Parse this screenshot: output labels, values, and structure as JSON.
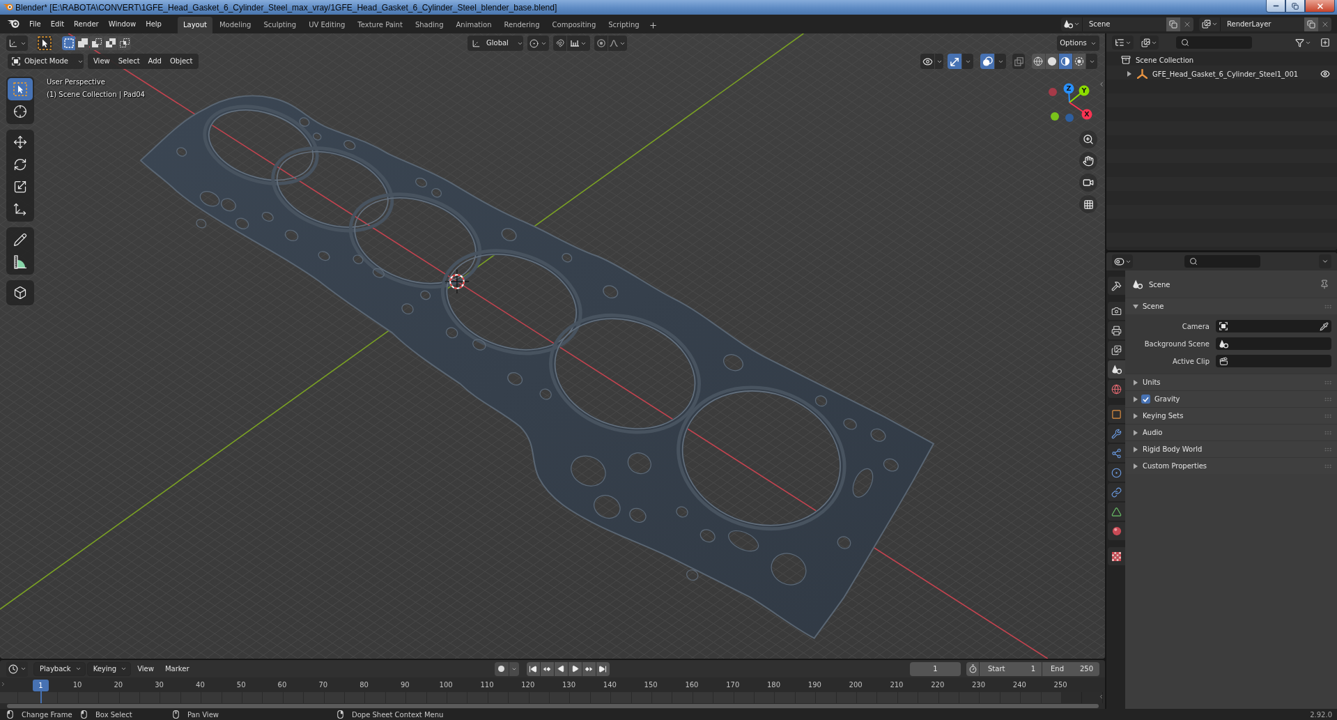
{
  "window": {
    "title": "Blender* [E:\\RABOTA\\CONVERT\\1GFE_Head_Gasket_6_Cylinder_Steel_max_vray/1GFE_Head_Gasket_6_Cylinder_Steel_blender_base.blend]"
  },
  "menu": [
    "File",
    "Edit",
    "Render",
    "Window",
    "Help"
  ],
  "workspaces": [
    {
      "label": "Layout",
      "selected": true
    },
    {
      "label": "Modeling",
      "selected": false
    },
    {
      "label": "Sculpting",
      "selected": false
    },
    {
      "label": "UV Editing",
      "selected": false
    },
    {
      "label": "Texture Paint",
      "selected": false
    },
    {
      "label": "Shading",
      "selected": false
    },
    {
      "label": "Animation",
      "selected": false
    },
    {
      "label": "Rendering",
      "selected": false
    },
    {
      "label": "Compositing",
      "selected": false
    },
    {
      "label": "Scripting",
      "selected": false
    }
  ],
  "scene": {
    "value": "Scene"
  },
  "view_layer": {
    "value": "RenderLayer"
  },
  "tool_header": {
    "select_modes": [
      {
        "kind": "set",
        "selected": true
      },
      {
        "kind": "extend",
        "selected": false
      },
      {
        "kind": "subtract",
        "selected": false
      },
      {
        "kind": "difference",
        "selected": false
      },
      {
        "kind": "intersect",
        "selected": false
      }
    ],
    "orientation": "Global",
    "options": "Options"
  },
  "viewport": {
    "mode": "Object Mode",
    "menus": [
      "View",
      "Select",
      "Add",
      "Object"
    ],
    "overlays": [
      {
        "kind": "visibility",
        "on": false
      },
      {
        "kind": "gizmos",
        "on": true
      },
      {
        "kind": "overlays",
        "on": true
      },
      {
        "kind": "xray",
        "on": false
      }
    ],
    "shading": [
      {
        "kind": "wireframe",
        "selected": false
      },
      {
        "kind": "solid",
        "selected": false
      },
      {
        "kind": "material",
        "selected": true
      },
      {
        "kind": "rendered",
        "selected": false
      }
    ],
    "view_name": "User Perspective",
    "info": "(1) Scene Collection | Pad04",
    "tool_groups": [
      {
        "tools": [
          {
            "kind": "select",
            "selected": true
          },
          {
            "kind": "cursor",
            "selected": false
          }
        ]
      },
      {
        "tools": [
          {
            "kind": "move",
            "selected": false
          },
          {
            "kind": "rotate",
            "selected": false
          },
          {
            "kind": "scale",
            "selected": false
          },
          {
            "kind": "transform",
            "selected": false
          }
        ]
      },
      {
        "tools": [
          {
            "kind": "annotate",
            "selected": false
          },
          {
            "kind": "measure",
            "selected": false
          }
        ]
      },
      {
        "tools": [
          {
            "kind": "add_cube",
            "selected": false
          }
        ]
      }
    ],
    "axes": [
      {
        "kind": "z",
        "label": "Z"
      },
      {
        "kind": "y",
        "label": "Y"
      },
      {
        "kind": "x",
        "label": "X"
      }
    ]
  },
  "outliner": {
    "root": "Scene Collection",
    "items": [
      {
        "name": "GFE_Head_Gasket_6_Cylinder_Steel1_001",
        "expanded": false,
        "visible": true
      }
    ]
  },
  "properties": {
    "tab_groups": [
      {
        "tabs": [
          {
            "kind": "tool",
            "selected": false
          }
        ]
      },
      {
        "tabs": [
          {
            "kind": "render",
            "selected": false
          },
          {
            "kind": "output",
            "selected": false
          },
          {
            "kind": "view_layer",
            "selected": false
          },
          {
            "kind": "scene",
            "selected": true
          },
          {
            "kind": "world",
            "selected": false
          }
        ]
      },
      {
        "tabs": [
          {
            "kind": "object",
            "selected": false
          },
          {
            "kind": "modifiers",
            "selected": false
          },
          {
            "kind": "particles",
            "selected": false
          },
          {
            "kind": "physics",
            "selected": false
          },
          {
            "kind": "constraints",
            "selected": false
          },
          {
            "kind": "data",
            "selected": false
          },
          {
            "kind": "material",
            "selected": false
          }
        ]
      },
      {
        "tabs": [
          {
            "kind": "texture",
            "selected": false
          }
        ]
      }
    ],
    "context": "Scene",
    "panels": [
      {
        "kind": "section",
        "label": "Scene",
        "expanded": true,
        "fields": [
          {
            "kind": "camera",
            "label": "Camera"
          },
          {
            "kind": "scene",
            "label": "Background Scene"
          },
          {
            "kind": "clip",
            "label": "Active Clip"
          }
        ]
      },
      {
        "kind": "section",
        "label": "Units",
        "expanded": false
      },
      {
        "kind": "toggle",
        "label": "Gravity",
        "expanded": false,
        "checked": true
      },
      {
        "kind": "section",
        "label": "Keying Sets",
        "expanded": false
      },
      {
        "kind": "section",
        "label": "Audio",
        "expanded": false
      },
      {
        "kind": "section",
        "label": "Rigid Body World",
        "expanded": false
      },
      {
        "kind": "section",
        "label": "Custom Properties",
        "expanded": false
      }
    ]
  },
  "timeline": {
    "menus": [
      {
        "kind": "dropdown",
        "label": "Playback"
      },
      {
        "kind": "dropdown",
        "label": "Keying"
      },
      {
        "kind": "menu",
        "label": "View"
      },
      {
        "kind": "menu",
        "label": "Marker"
      }
    ],
    "auto_keying": false,
    "current_frame": "1",
    "start_label": "Start",
    "start": "1",
    "end_label": "End",
    "end": "250",
    "playhead": "1",
    "ticks": [
      "10",
      "20",
      "30",
      "40",
      "50",
      "60",
      "70",
      "80",
      "90",
      "100",
      "110",
      "120",
      "130",
      "140",
      "150",
      "160",
      "170",
      "180",
      "190",
      "200",
      "210",
      "220",
      "230",
      "240",
      "250"
    ]
  },
  "status_bar": {
    "hints": [
      {
        "kind": "left_click",
        "label": "Change Frame"
      },
      {
        "kind": "left_drag",
        "label": "Box Select"
      },
      {
        "kind": "middle_click",
        "label": "Pan View"
      },
      {
        "kind": "right_click",
        "label": "Dope Sheet Context Menu"
      }
    ],
    "version": "2.92.0"
  }
}
